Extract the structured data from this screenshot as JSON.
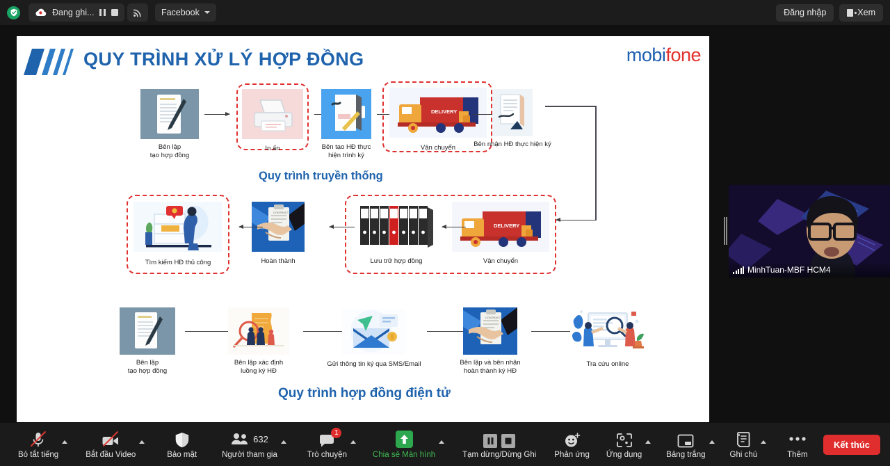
{
  "topbar": {
    "shield_icon": "shield-check-icon",
    "recording_label": "Đang ghi...",
    "pause_icon": "pause-icon",
    "stop_icon": "stop-icon",
    "cast_icon": "broadcast-icon",
    "streaming_service": "Facebook",
    "caret_icon": "chevron-down-icon",
    "login_label": "Đăng nhập",
    "view_label": "Xem",
    "view_icon": "view-icon"
  },
  "slide": {
    "logo_icon": "mobifone-stripes-logo",
    "title": "QUY TRÌNH XỬ LÝ HỢP ĐỒNG",
    "brand_part1": "mobi",
    "brand_part2": "fone",
    "brand_color_1": "#1d61b0",
    "brand_color_2": "#e2322c",
    "title_color": "#1f63ad",
    "highlight_color": "#e03030",
    "section_traditional": "Quy trình truyền thống",
    "section_electronic": "Quy trình hợp đồng điện tử",
    "row1": [
      {
        "caption_l1": "Bên lập",
        "caption_l2": "tạo hợp đồng",
        "icon": "contract-document-pen-icon",
        "highlighted": false
      },
      {
        "caption_l1": "In ấn",
        "caption_l2": "",
        "icon": "printer-icon",
        "highlighted": true
      },
      {
        "caption_l1": "Bên tạo HĐ thực",
        "caption_l2": "hiện trình ký",
        "icon": "sign-document-icon",
        "highlighted": false
      },
      {
        "caption_l1": "Vận chuyển",
        "caption_l2": "",
        "icon": "delivery-truck-icon",
        "highlighted": true
      },
      {
        "caption_l1": "Bên nhận HĐ thực hiện ký",
        "caption_l2": "",
        "icon": "receive-sign-document-icon",
        "highlighted": false
      }
    ],
    "row2": [
      {
        "caption_l1": "Tìm kiếm HĐ thủ công",
        "caption_l2": "",
        "icon": "manual-search-files-icon",
        "highlighted": true
      },
      {
        "caption_l1": "Hoàn thành",
        "caption_l2": "",
        "icon": "handshake-contract-icon",
        "highlighted": false
      },
      {
        "caption_l1": "Lưu trữ hợp đồng",
        "caption_l2": "",
        "icon": "binders-archive-icon",
        "highlighted": true
      },
      {
        "caption_l1": "Vận chuyển",
        "caption_l2": "",
        "icon": "delivery-truck-icon",
        "highlighted": true
      }
    ],
    "row3": [
      {
        "caption_l1": "Bên lập",
        "caption_l2": "tạo hợp đồng",
        "icon": "contract-document-pen-icon"
      },
      {
        "caption_l1": "Bên lập xác định",
        "caption_l2": "luồng ký HĐ",
        "icon": "search-workflow-icon"
      },
      {
        "caption_l1": "Gửi thông tin ký qua SMS/Email",
        "caption_l2": "",
        "icon": "send-email-icon"
      },
      {
        "caption_l1": "Bên lập và bên nhận",
        "caption_l2": "hoàn thành ký HĐ",
        "icon": "handshake-contract-icon"
      },
      {
        "caption_l1": "Tra cứu online",
        "caption_l2": "",
        "icon": "online-lookup-icon"
      }
    ],
    "truck_label": "DELIVERY",
    "contract_label": "CONTRACT"
  },
  "video": {
    "participant_name": "MinhTuan-MBF HCM4",
    "signal_icon": "signal-bars-icon"
  },
  "toolbar": {
    "items": [
      {
        "label": "Bỏ tắt tiếng",
        "icon": "microphone-muted-icon",
        "has_chevron": true,
        "green": false
      },
      {
        "label": "Bắt đầu Video",
        "icon": "camera-off-icon",
        "has_chevron": true,
        "green": false
      },
      {
        "label": "Bảo mật",
        "icon": "shield-icon",
        "has_chevron": false,
        "green": false
      },
      {
        "label": "Người tham gia",
        "icon": "participants-icon",
        "has_chevron": true,
        "green": false,
        "count": "632"
      },
      {
        "label": "Trò chuyện",
        "icon": "chat-bubble-icon",
        "has_chevron": true,
        "green": false,
        "badge": "1"
      },
      {
        "label": "Chia sẻ Màn hình",
        "icon": "share-screen-up-arrow-icon",
        "has_chevron": true,
        "green": true
      },
      {
        "label": "Tạm dừng/Dừng Ghi",
        "icon": "pause-stop-recording-icon",
        "has_chevron": false,
        "green": false
      },
      {
        "label": "Phản ứng",
        "icon": "reactions-smiley-icon",
        "has_chevron": false,
        "green": false
      },
      {
        "label": "Ứng dụng",
        "icon": "apps-icon",
        "has_chevron": true,
        "green": false
      },
      {
        "label": "Bảng trắng",
        "icon": "whiteboard-icon",
        "has_chevron": true,
        "green": false
      },
      {
        "label": "Ghi chú",
        "icon": "notes-icon",
        "has_chevron": true,
        "green": false
      },
      {
        "label": "Thêm",
        "icon": "more-dots-icon",
        "has_chevron": false,
        "green": false
      }
    ],
    "end_label": "Kết thúc",
    "end_color": "#e02d2d"
  }
}
